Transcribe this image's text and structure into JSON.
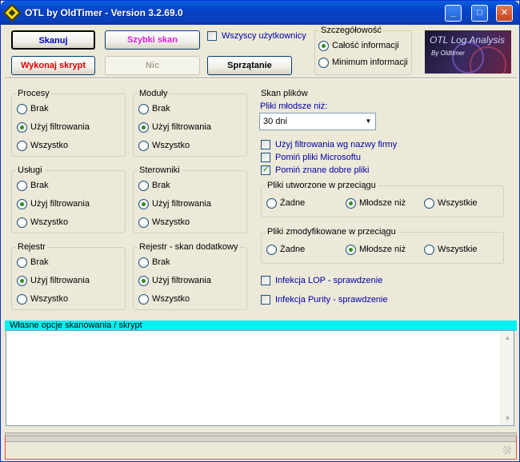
{
  "window": {
    "title": "OTL by OldTimer - Version 3.2.69.0",
    "min": "_",
    "max": "□",
    "close": "✕"
  },
  "toolbar": {
    "scan": "Skanuj",
    "quick_scan": "Szybki skan",
    "run_script": "Wykonaj skrypt",
    "nothing": "Nic",
    "cleanup": "Sprzątanie",
    "all_users": "Wszyscy użytkownicy"
  },
  "detail": {
    "legend": "Szczegółowość",
    "full": "Całość informacji",
    "minimum": "Minimum informacji"
  },
  "logo": {
    "title": "OTL Log Analysis",
    "sub": "By Oldtimer"
  },
  "options": {
    "none": "Brak",
    "filter": "Użyj filtrowania",
    "all": "Wszystko"
  },
  "groups": {
    "processes": "Procesy",
    "modules": "Moduły",
    "services": "Usługi",
    "drivers": "Sterowniki",
    "registry": "Rejestr",
    "registry_extra": "Rejestr - skan dodatkowy"
  },
  "file_scan": {
    "legend": "Skan plików",
    "newer_label": "Pliki młodsze niż:",
    "newer_value": "30 dni",
    "company_filter": "Użyj filtrowania wg nazwy firmy",
    "skip_ms": "Pomiń pliki Microsoftu",
    "skip_good": "Pomiń znane dobre pliki",
    "created": {
      "legend": "Pliki utworzone w przeciągu",
      "none": "Żadne",
      "newer": "Młodsze niż",
      "all": "Wszystkie"
    },
    "modified": {
      "legend": "Pliki zmodyfikowane w przeciągu",
      "none": "Żadne",
      "newer": "Młodsze niż",
      "all": "Wszystkie"
    },
    "lop": "Infekcja LOP - sprawdzenie",
    "purity": "Infekcja Purity - sprawdzenie"
  },
  "custom": {
    "label": "Własne opcje skanowania / skrypt",
    "value": ""
  }
}
